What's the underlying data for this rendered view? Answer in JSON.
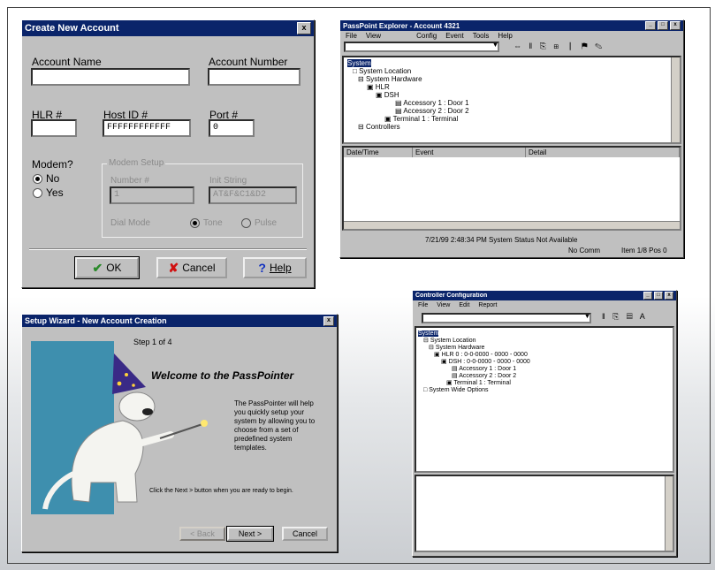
{
  "create_account": {
    "title": "Create New Account",
    "close": "x",
    "account_name_label": "Account Name",
    "account_number_label": "Account Number",
    "hlr_label": "HLR #",
    "host_id_label": "Host ID #",
    "port_label": "Port #",
    "host_id_value": "FFFFFFFFFFFF",
    "port_value": "0",
    "modem_label": "Modem?",
    "radio_no": "No",
    "radio_yes": "Yes",
    "modem_group": "Modem Setup",
    "number_label": "Number #",
    "init_label": "Init String",
    "number_value": "1",
    "init_value": "AT&F&C1&D2",
    "dial_label": "Dial Mode",
    "tone": "Tone",
    "pulse": "Pulse",
    "ok": "OK",
    "cancel": "Cancel",
    "help": "Help"
  },
  "explorer": {
    "title": "PassPoint Explorer - Account 4321",
    "menus": [
      "File",
      "View",
      "Config",
      "Event",
      "Tools",
      "Help"
    ],
    "tree": [
      "System",
      "System Location",
      "System Hardware",
      "HLR",
      "DSH",
      "Accessory 1 : Door 1",
      "Accessory 2 : Door 2",
      "Terminal 1 : Terminal",
      "Controllers"
    ],
    "columns": [
      "Date/Time",
      "Event",
      "Detail"
    ],
    "status_line": "7/21/99 2:48:34 PM    System Status Not Available",
    "status_right": [
      "No Comm",
      "Item 1/8   Pos 0"
    ]
  },
  "wizard": {
    "title": "Setup Wizard - New Account Creation",
    "step": "Step 1 of 4",
    "heading": "Welcome to the PassPointer",
    "body": "The PassPointer will help you quickly setup your system by allowing you to choose from a set of predefined system templates.",
    "hint": "Click the Next > button when you are ready to begin.",
    "back": "< Back",
    "next": "Next >",
    "cancel": "Cancel"
  },
  "config": {
    "title": "Controller Configuration",
    "menus": [
      "File",
      "View",
      "Edit",
      "Report"
    ],
    "tree": [
      "System",
      "System Location",
      "System Hardware",
      "HLR 0 : 0-0-0000 - 0000 - 0000",
      "DSH : 0-0-0000 - 0000 - 0000",
      "Accessory 1 : Door 1",
      "Accessory 2 : Door 2",
      "Terminal 1 : Terminal",
      "System Wide Options"
    ]
  }
}
